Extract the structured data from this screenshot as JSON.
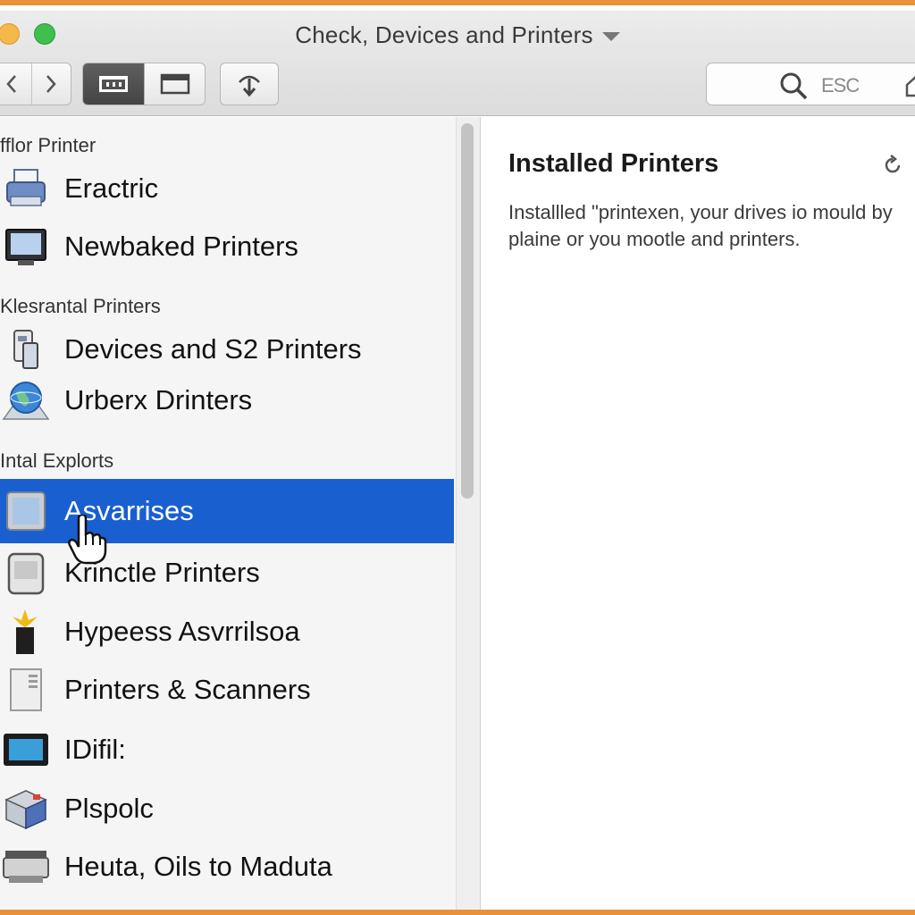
{
  "window": {
    "title": "Check, Devices and Printers"
  },
  "toolbar": {
    "back_icon": "chevron-left-icon",
    "forward_icon": "chevron-right-icon",
    "views": [
      "grid-view-icon",
      "window-view-icon"
    ],
    "share_icon": "share-icon",
    "search_text": "ESC"
  },
  "sidebar": {
    "sections": [
      {
        "heading": "fflor Printer",
        "items": [
          {
            "label": "Eractric",
            "icon": "printer-icon"
          },
          {
            "label": "Newbaked Printers",
            "icon": "monitor-icon"
          }
        ]
      },
      {
        "heading": "Klesrantal Printers",
        "items": [
          {
            "label": "Devices and S2 Printers",
            "icon": "devices-icon"
          },
          {
            "label": "Urberx Drinters",
            "icon": "globe-icon"
          }
        ]
      },
      {
        "heading": "Intal Explorts",
        "items": [
          {
            "label": "Asvarrises",
            "icon": "tablet-icon",
            "selected": true
          },
          {
            "label": "Krinctle Printers",
            "icon": "device-icon"
          },
          {
            "label": "Hypeess Asvrrilsoa",
            "icon": "lamp-icon"
          },
          {
            "label": "Printers & Scanners",
            "icon": "tower-icon"
          },
          {
            "label": "IDifil:",
            "icon": "display-icon"
          },
          {
            "label": "Plspolc",
            "icon": "box-icon"
          },
          {
            "label": "Heuta, Oils to Maduta",
            "icon": "scanner-icon"
          }
        ]
      }
    ]
  },
  "main": {
    "title": "Installed Printers",
    "description": "Installled \"printeхen, your drives io mould by plaine or you mootle and printers."
  },
  "colors": {
    "selection": "#1a5fd0",
    "frame_border": "#e8913a"
  }
}
